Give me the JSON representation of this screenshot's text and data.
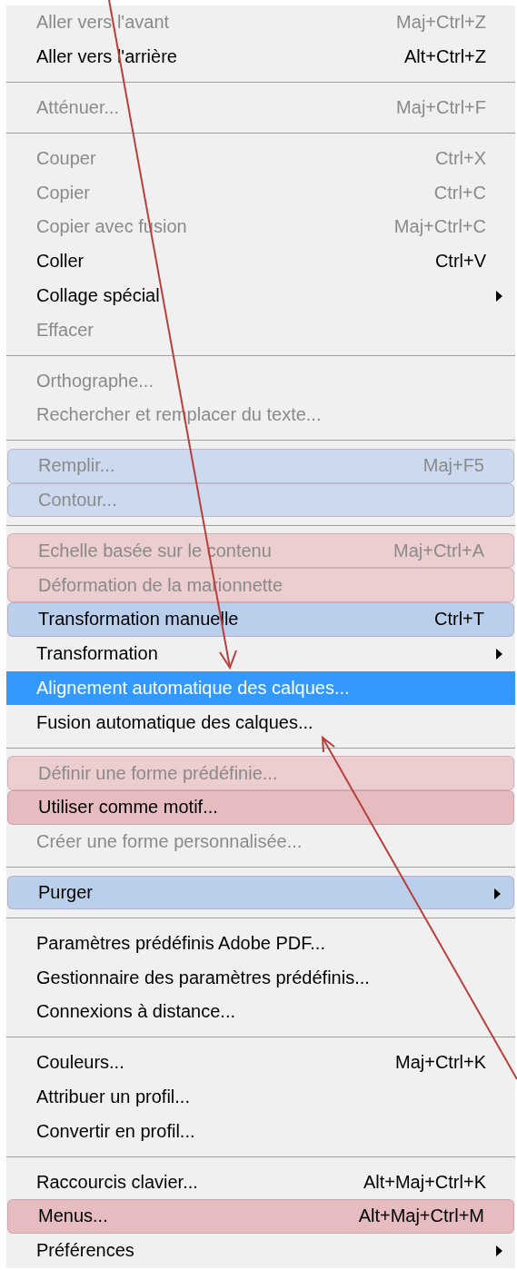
{
  "menu": {
    "sections": [
      {
        "items": [
          {
            "label": "Aller vers l'avant",
            "shortcut": "Maj+Ctrl+Z",
            "disabled": true,
            "submenu": false,
            "selected": false
          },
          {
            "label": "Aller vers l'arrière",
            "shortcut": "Alt+Ctrl+Z",
            "disabled": false,
            "submenu": false,
            "selected": false
          }
        ]
      },
      {
        "items": [
          {
            "label": "Atténuer...",
            "shortcut": "Maj+Ctrl+F",
            "disabled": true,
            "submenu": false,
            "selected": false
          }
        ]
      },
      {
        "items": [
          {
            "label": "Couper",
            "shortcut": "Ctrl+X",
            "disabled": true,
            "submenu": false,
            "selected": false
          },
          {
            "label": "Copier",
            "shortcut": "Ctrl+C",
            "disabled": true,
            "submenu": false,
            "selected": false
          },
          {
            "label": "Copier avec fusion",
            "shortcut": "Maj+Ctrl+C",
            "disabled": true,
            "submenu": false,
            "selected": false
          },
          {
            "label": "Coller",
            "shortcut": "Ctrl+V",
            "disabled": false,
            "submenu": false,
            "selected": false
          },
          {
            "label": "Collage spécial",
            "disabled": false,
            "submenu": true,
            "selected": false
          },
          {
            "label": "Effacer",
            "disabled": true,
            "submenu": false,
            "selected": false
          }
        ]
      },
      {
        "items": [
          {
            "label": "Orthographe...",
            "disabled": true,
            "submenu": false,
            "selected": false
          },
          {
            "label": "Rechercher et remplacer du texte...",
            "disabled": true,
            "submenu": false,
            "selected": false
          }
        ]
      },
      {
        "items": [
          {
            "label": "Remplir...",
            "shortcut": "Maj+F5",
            "disabled": true,
            "submenu": false,
            "selected": false,
            "color": "#cbdaee"
          },
          {
            "label": "Contour...",
            "disabled": true,
            "submenu": false,
            "selected": false,
            "color": "#cbdaee"
          }
        ]
      },
      {
        "items": [
          {
            "label": "Echelle basée sur le contenu",
            "shortcut": "Maj+Ctrl+A",
            "disabled": true,
            "submenu": false,
            "selected": false,
            "color": "#eccdd0"
          },
          {
            "label": "Déformation de la marionnette",
            "disabled": true,
            "submenu": false,
            "selected": false,
            "color": "#eccdd0"
          },
          {
            "label": "Transformation manuelle",
            "shortcut": "Ctrl+T",
            "disabled": false,
            "submenu": false,
            "selected": false,
            "color": "#bacfeb"
          },
          {
            "label": "Transformation",
            "disabled": false,
            "submenu": true,
            "selected": false
          },
          {
            "label": "Alignement automatique des calques...",
            "disabled": false,
            "submenu": false,
            "selected": true
          },
          {
            "label": "Fusion automatique des calques...",
            "disabled": false,
            "submenu": false,
            "selected": false
          }
        ]
      },
      {
        "items": [
          {
            "label": "Définir une forme prédéfinie...",
            "disabled": true,
            "submenu": false,
            "selected": false,
            "color": "#eccdd0"
          },
          {
            "label": "Utiliser comme motif...",
            "disabled": false,
            "submenu": false,
            "selected": false,
            "color": "#e6bcc0"
          },
          {
            "label": "Créer une forme personnalisée...",
            "disabled": true,
            "submenu": false,
            "selected": false
          }
        ]
      },
      {
        "items": [
          {
            "label": "Purger",
            "disabled": false,
            "submenu": true,
            "selected": false,
            "color": "#bacfeb"
          }
        ]
      },
      {
        "items": [
          {
            "label": "Paramètres prédéfinis Adobe PDF...",
            "disabled": false,
            "submenu": false,
            "selected": false
          },
          {
            "label": "Gestionnaire des paramètres prédéfinis...",
            "disabled": false,
            "submenu": false,
            "selected": false
          },
          {
            "label": "Connexions à distance...",
            "disabled": false,
            "submenu": false,
            "selected": false
          }
        ]
      },
      {
        "items": [
          {
            "label": "Couleurs...",
            "shortcut": "Maj+Ctrl+K",
            "disabled": false,
            "submenu": false,
            "selected": false
          },
          {
            "label": "Attribuer un profil...",
            "disabled": false,
            "submenu": false,
            "selected": false
          },
          {
            "label": "Convertir en profil...",
            "disabled": false,
            "submenu": false,
            "selected": false
          }
        ]
      },
      {
        "items": [
          {
            "label": "Raccourcis clavier...",
            "shortcut": "Alt+Maj+Ctrl+K",
            "disabled": false,
            "submenu": false,
            "selected": false
          },
          {
            "label": "Menus...",
            "shortcut": "Alt+Maj+Ctrl+M",
            "disabled": false,
            "submenu": false,
            "selected": false,
            "color": "#e6bcc0"
          },
          {
            "label": "Préférences",
            "disabled": false,
            "submenu": true,
            "selected": false
          }
        ]
      }
    ]
  }
}
